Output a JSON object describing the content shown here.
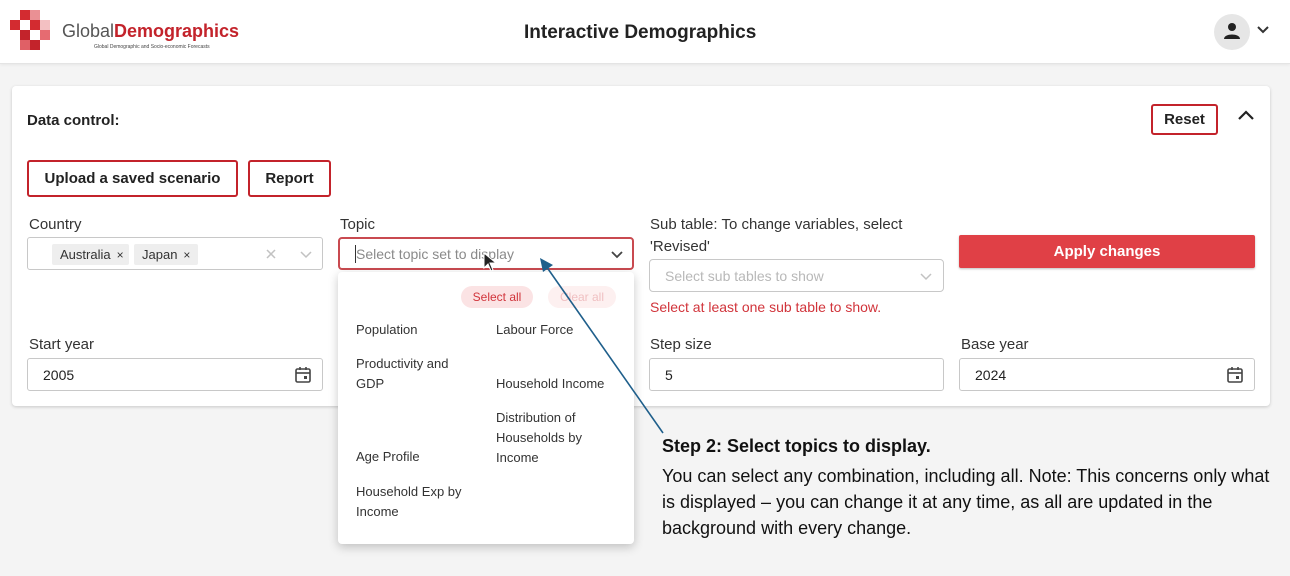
{
  "header": {
    "logo_prefix": "Global",
    "logo_brand": "Demographics",
    "logo_tagline": "Global Demographic and Socio-economic Forecasts",
    "title": "Interactive Demographics",
    "user_icon": "user-icon",
    "menu_icon": "chevron-down-icon"
  },
  "panel": {
    "label": "Data control:",
    "reset_label": "Reset",
    "collapse_icon": "chevron-up-icon",
    "upload_label": "Upload a saved scenario",
    "report_label": "Report",
    "country": {
      "label": "Country",
      "chips": [
        "Australia",
        "Japan"
      ],
      "chip_remove": "×",
      "clear_icon": "clear-icon"
    },
    "topic": {
      "label": "Topic",
      "placeholder": "Select topic set to display"
    },
    "subtable": {
      "label_line1": "Sub table: To change variables, select",
      "label_line2": "'Revised'",
      "placeholder": "Select sub tables to show",
      "error": "Select at least one sub table to show."
    },
    "apply_label": "Apply changes",
    "start_year": {
      "label": "Start year",
      "value": "2005"
    },
    "step_size": {
      "label": "Step size",
      "value": "5"
    },
    "base_year": {
      "label": "Base year",
      "value": "2024"
    }
  },
  "dropdown": {
    "select_all": "Select all",
    "clear_all": "Clear all",
    "options_left": [
      {
        "lines": [
          "Population"
        ]
      },
      {
        "lines": [
          "Productivity and",
          "GDP"
        ]
      },
      {
        "lines": [
          "Age Profile"
        ]
      },
      {
        "lines": [
          "Household Exp by",
          "Income"
        ]
      }
    ],
    "options_right": [
      {
        "lines": [
          "Labour Force"
        ]
      },
      {
        "lines": [
          "Household Income"
        ]
      },
      {
        "lines": [
          "Distribution of",
          "Households by",
          "Income"
        ]
      }
    ]
  },
  "annotation": {
    "step_title": "Step 2:  Select topics to display.",
    "step_body": "You can select any combination, including all.  Note: This concerns only what is displayed – you can change it at any time, as all are updated in the background with every change.",
    "arrow_color": "#1f5f8b"
  },
  "colors": {
    "accent": "#c3232b",
    "apply": "#e04046",
    "error": "#d1343b"
  }
}
